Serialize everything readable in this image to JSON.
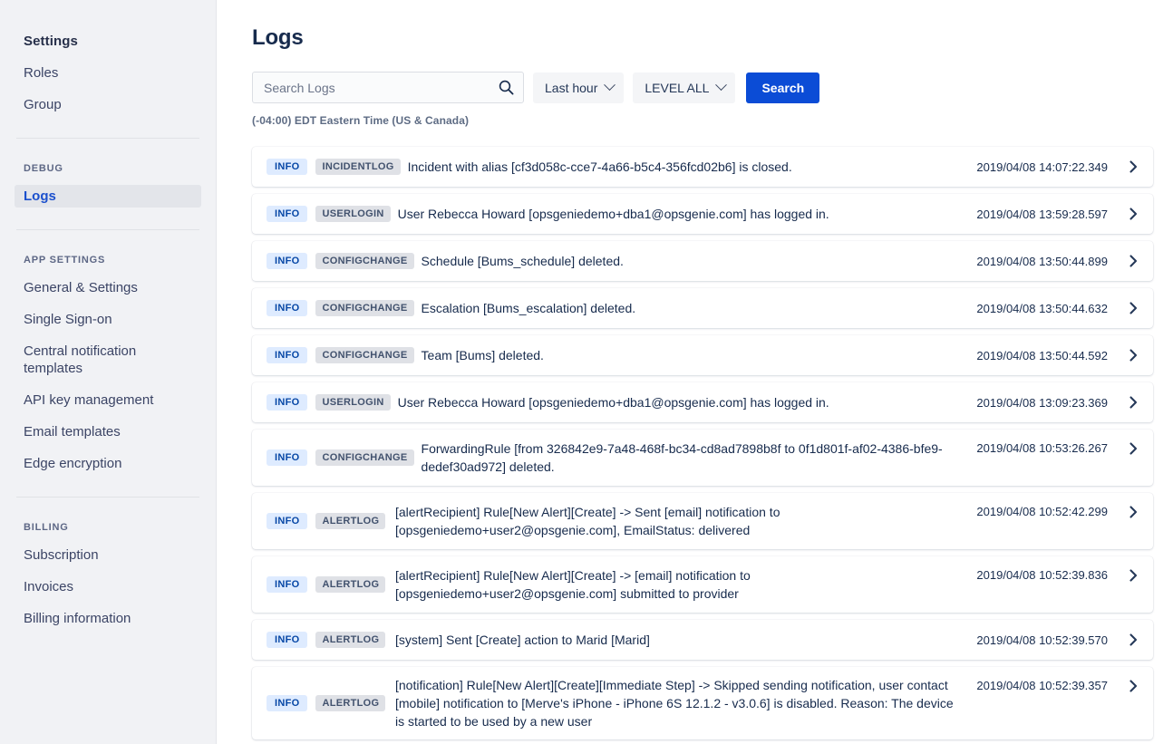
{
  "sidebar": {
    "groups": [
      {
        "title": "Settings",
        "items": [
          {
            "label": "Roles",
            "active": false
          },
          {
            "label": "Group",
            "active": false
          }
        ]
      }
    ],
    "debug_label": "DEBUG",
    "debug_items": [
      {
        "label": "Logs",
        "active": true
      }
    ],
    "app_settings_label": "APP SETTINGS",
    "app_settings_items": [
      {
        "label": "General & Settings"
      },
      {
        "label": "Single Sign-on"
      },
      {
        "label": "Central notification templates"
      },
      {
        "label": "API key management"
      },
      {
        "label": "Email templates"
      },
      {
        "label": "Edge encryption"
      }
    ],
    "billing_label": "BILLING",
    "billing_items": [
      {
        "label": "Subscription"
      },
      {
        "label": "Invoices"
      },
      {
        "label": "Billing information"
      }
    ]
  },
  "header": {
    "title": "Logs"
  },
  "toolbar": {
    "search_placeholder": "Search Logs",
    "search_value": "",
    "time_range": "Last hour",
    "level": "LEVEL ALL",
    "search_button": "Search",
    "timezone": "(-04:00) EDT Eastern Time (US & Canada)"
  },
  "colors": {
    "accent": "#0B4CD6",
    "sidebar_bg": "#F1F2F5",
    "badge_level_bg": "#DEEBFF",
    "badge_level_text": "#0747A6",
    "badge_type_bg": "#DFE1E6",
    "badge_type_text": "#42526E",
    "active_nav_text": "#1B50CD"
  },
  "logs": [
    {
      "level": "INFO",
      "type": "INCIDENTLOG",
      "message": "Incident with alias [cf3d058c-cce7-4a66-b5c4-356fcd02b6] is closed.",
      "timestamp": "2019/04/08 14:07:22.349",
      "lines": 1
    },
    {
      "level": "INFO",
      "type": "USERLOGIN",
      "message": "User Rebecca Howard [opsgeniedemo+dba1@opsgenie.com] has logged in.",
      "timestamp": "2019/04/08 13:59:28.597",
      "lines": 1
    },
    {
      "level": "INFO",
      "type": "CONFIGCHANGE",
      "message": "Schedule [Bums_schedule] deleted.",
      "timestamp": "2019/04/08 13:50:44.899",
      "lines": 1
    },
    {
      "level": "INFO",
      "type": "CONFIGCHANGE",
      "message": "Escalation [Bums_escalation] deleted.",
      "timestamp": "2019/04/08 13:50:44.632",
      "lines": 1
    },
    {
      "level": "INFO",
      "type": "CONFIGCHANGE",
      "message": "Team [Bums] deleted.",
      "timestamp": "2019/04/08 13:50:44.592",
      "lines": 1
    },
    {
      "level": "INFO",
      "type": "USERLOGIN",
      "message": "User Rebecca Howard [opsgeniedemo+dba1@opsgenie.com] has logged in.",
      "timestamp": "2019/04/08 13:09:23.369",
      "lines": 1
    },
    {
      "level": "INFO",
      "type": "CONFIGCHANGE",
      "message": "ForwardingRule [from 326842e9-7a48-468f-bc34-cd8ad7898b8f to 0f1d801f-af02-4386-bfe9-dedef30ad972] deleted.",
      "timestamp": "2019/04/08 10:53:26.267",
      "lines": 2
    },
    {
      "level": "INFO",
      "type": "ALERTLOG",
      "message": "[alertRecipient] Rule[New Alert][Create] -> Sent [email] notification to [opsgeniedemo+user2@opsgenie.com], EmailStatus: delivered",
      "timestamp": "2019/04/08 10:52:42.299",
      "lines": 2
    },
    {
      "level": "INFO",
      "type": "ALERTLOG",
      "message": "[alertRecipient] Rule[New Alert][Create] -> [email] notification to [opsgeniedemo+user2@opsgenie.com] submitted to provider",
      "timestamp": "2019/04/08 10:52:39.836",
      "lines": 2
    },
    {
      "level": "INFO",
      "type": "ALERTLOG",
      "message": "[system] Sent [Create] action to Marid [Marid]",
      "timestamp": "2019/04/08 10:52:39.570",
      "lines": 1
    },
    {
      "level": "INFO",
      "type": "ALERTLOG",
      "message": "[notification] Rule[New Alert][Create][Immediate Step] -> Skipped sending notification, user contact [mobile] notification to [Merve's iPhone - iPhone 6S 12.1.2 - v3.0.6] is disabled. Reason: The device is started to be used by a new user",
      "timestamp": "2019/04/08 10:52:39.357",
      "lines": 3
    }
  ]
}
